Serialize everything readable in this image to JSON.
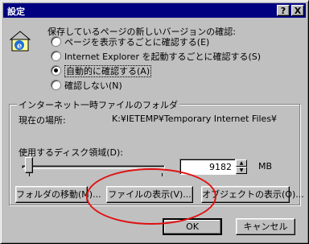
{
  "window": {
    "title": "設定",
    "help_btn": "?",
    "close_btn": "X"
  },
  "check_section": {
    "heading": "保存しているページの新しいバージョンの確認:",
    "options": [
      {
        "label": "ページを表示するごとに確認する(E)",
        "selected": false
      },
      {
        "label": "Internet Explorer を起動するごとに確認する(S)",
        "selected": false
      },
      {
        "label": "自動的に確認する(A)",
        "selected": true
      },
      {
        "label": "確認しない(N)",
        "selected": false
      }
    ]
  },
  "temp_files": {
    "group_label": "インターネット一時ファイルのフォルダ",
    "location_label": "現在の場所:",
    "location_value": "K:¥IETEMP¥Temporary Internet Files¥",
    "disk_label": "使用するディスク領域(D):",
    "disk_value": "9182",
    "disk_unit": "MB",
    "disk_slider_fraction": 0.04,
    "buttons": {
      "move_folder": "フォルダの移動(M)...",
      "view_files": "ファイルの表示(V)...",
      "view_objects": "オブジェクトの表示(O)..."
    }
  },
  "footer": {
    "ok": "OK",
    "cancel": "キャンセル"
  },
  "annotation": {
    "color": "#e01010"
  }
}
